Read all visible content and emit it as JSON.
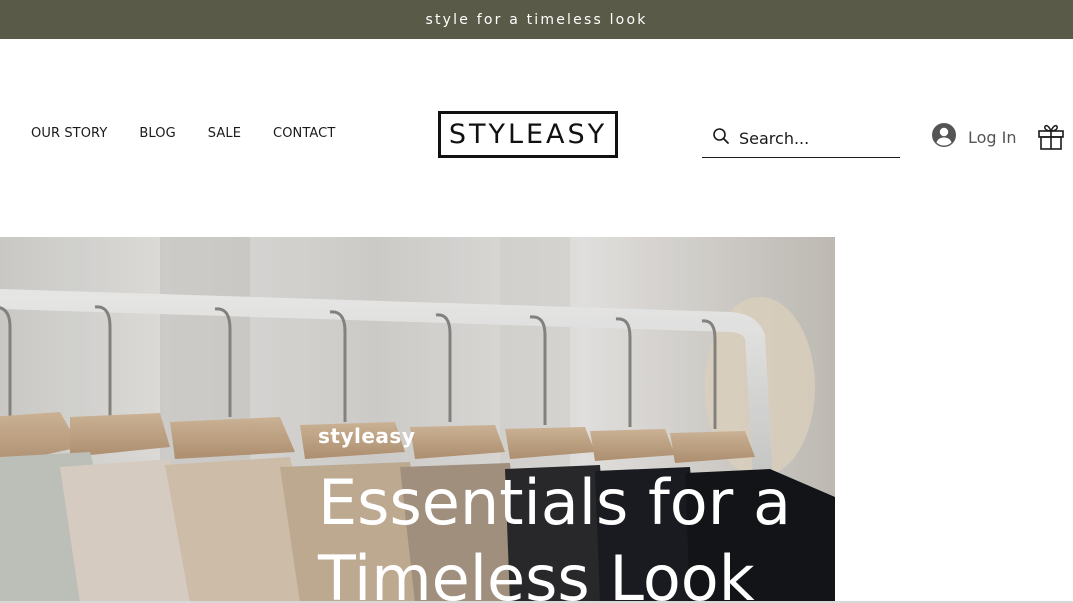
{
  "announcement": {
    "text": "style for a timeless look"
  },
  "nav": {
    "items": [
      {
        "label": "OUR STORY"
      },
      {
        "label": "BLOG"
      },
      {
        "label": "SALE"
      },
      {
        "label": "CONTACT"
      }
    ]
  },
  "logo": {
    "text": "STYLEASY"
  },
  "search": {
    "placeholder": "Search..."
  },
  "login": {
    "label": "Log In"
  },
  "hero": {
    "brand": "styleasy",
    "headline_line1": "Essentials for a",
    "headline_line2": "Timeless Look"
  },
  "colors": {
    "announcement_bg": "#5a5a48",
    "text": "#1a1a1a",
    "login_text": "#555555"
  },
  "icons": [
    "search-icon",
    "user-avatar-icon",
    "gift-icon"
  ]
}
